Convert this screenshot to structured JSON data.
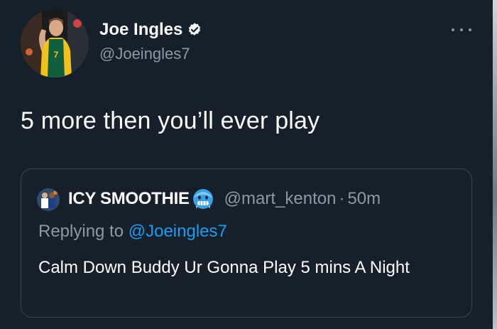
{
  "tweet": {
    "display_name": "Joe Ingles",
    "handle": "@Joeingles7",
    "text": "5 more then you’ll ever play",
    "avatar_icon": "player-photo-avatar",
    "verified_icon": "verified-badge-icon",
    "more_icon": "more-dots-icon"
  },
  "quote": {
    "display_name": "ICY SMOOTHIE",
    "handle": "@mart_kenton",
    "separator": "·",
    "time": "50m",
    "replying_prefix": "Replying to",
    "replying_to": "@Joeingles7",
    "text": "Calm Down Buddy Ur Gonna Play 5 mins A Night",
    "emoji_icon": "cold-face-emoji"
  },
  "colors": {
    "background": "#15202b",
    "primary_text": "#ffffff",
    "secondary_text": "#8b98a5",
    "link": "#1d9bf0",
    "border": "#38444d"
  }
}
